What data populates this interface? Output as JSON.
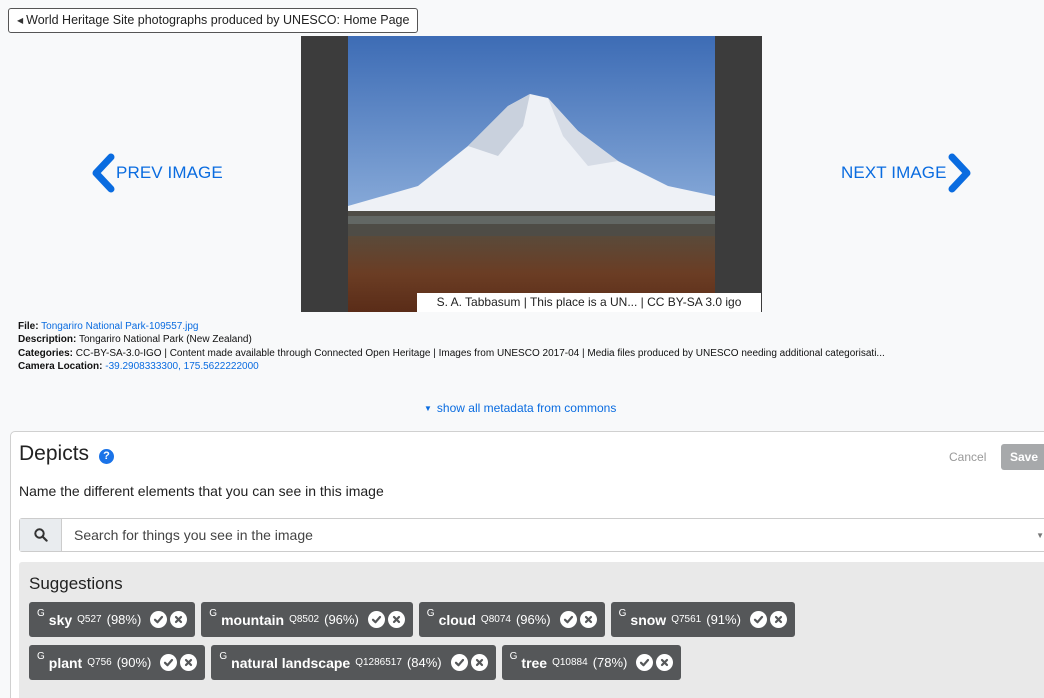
{
  "back_link": {
    "label": "World Heritage Site photographs produced by UNESCO: Home Page"
  },
  "viewer": {
    "attribution": "S. A. Tabbasum | This place is a UN... | CC BY-SA 3.0 igo",
    "prev_label": "PREV IMAGE",
    "next_label": "NEXT IMAGE"
  },
  "metadata": {
    "file_label": "File:",
    "file_value": "Tongariro National Park-109557.jpg",
    "description_label": "Description:",
    "description_value": "Tongariro National Park (New Zealand)",
    "categories_label": "Categories:",
    "categories_value": "CC-BY-SA-3.0-IGO | Content made available through Connected Open Heritage | Images from UNESCO 2017-04 | Media files produced by UNESCO needing additional categorisati...",
    "camera_label": "Camera Location:",
    "camera_value": "-39.2908333300, 175.5622222000",
    "show_all": "show all metadata from commons"
  },
  "depicts": {
    "title": "Depicts",
    "help_icon": "?",
    "cancel_label": "Cancel",
    "save_label": "Save",
    "subtitle": "Name the different elements that you can see in this image",
    "search_placeholder": "Search for things you see in the image",
    "suggestions_title": "Suggestions",
    "suggestions": [
      {
        "source": "G",
        "label": "sky",
        "qid": "Q527",
        "pct": "(98%)"
      },
      {
        "source": "G",
        "label": "mountain",
        "qid": "Q8502",
        "pct": "(96%)"
      },
      {
        "source": "G",
        "label": "cloud",
        "qid": "Q8074",
        "pct": "(96%)"
      },
      {
        "source": "G",
        "label": "snow",
        "qid": "Q7561",
        "pct": "(91%)"
      },
      {
        "source": "G",
        "label": "plant",
        "qid": "Q756",
        "pct": "(90%)"
      },
      {
        "source": "G",
        "label": "natural landscape",
        "qid": "Q1286517",
        "pct": "(84%)"
      },
      {
        "source": "G",
        "label": "tree",
        "qid": "Q10884",
        "pct": "(78%)"
      }
    ]
  },
  "colors": {
    "link": "#0a6ce0",
    "chip": "#555759",
    "help": "#1a73e8"
  }
}
